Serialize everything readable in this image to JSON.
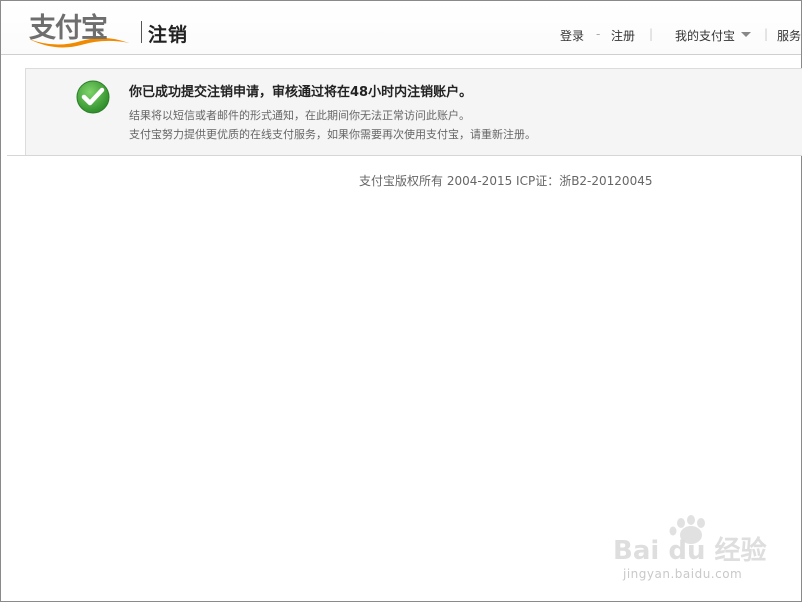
{
  "header": {
    "logo_text": "支付宝",
    "title": "注销",
    "nav": {
      "login": "登录",
      "separator": "-",
      "register": "注册",
      "my_alipay": "我的支付宝",
      "service": "服务"
    }
  },
  "notice": {
    "icon": "success-check-icon",
    "title": "你已成功提交注销申请，审核通过将在48小时内注销账户。",
    "line1": "结果将以短信或者邮件的形式通知，在此期间你无法正常访问此账户。",
    "line2": "支付宝努力提供更优质的在线支付服务，如果你需要再次使用支付宝，请重新注册。"
  },
  "footer": {
    "copyright": "支付宝版权所有  2004-2015 ICP证：浙B2-20120045"
  },
  "watermark": {
    "brand": "Bai du 经验",
    "url": "jingyan.baidu.com"
  },
  "colors": {
    "logo_orange": "#f08a00",
    "logo_gray": "#6e6e6e",
    "success_green": "#3fa53a"
  }
}
